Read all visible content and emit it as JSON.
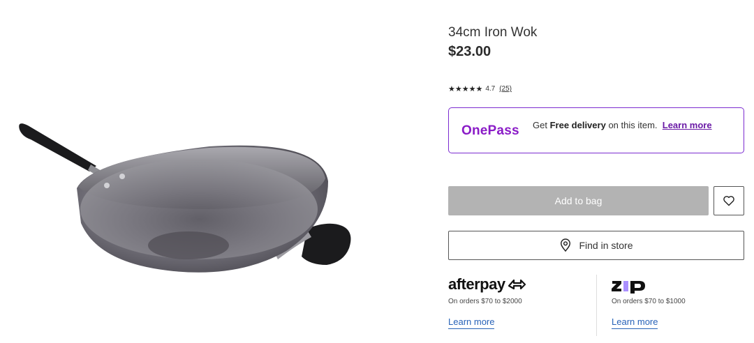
{
  "product": {
    "title": "34cm Iron Wok",
    "price": "$23.00",
    "rating": {
      "stars": "★★★★★",
      "value": 4.7,
      "score_text": "4.7",
      "count_text": "(25)"
    }
  },
  "onepass": {
    "logo": "OnePass",
    "text_before": "Get",
    "text_bold": "Free delivery",
    "text_after": "on this item.",
    "learn_more": "Learn more"
  },
  "actions": {
    "add_to_bag": "Add to bag",
    "find_in_store": "Find in store",
    "wishlist_icon": "heart-icon",
    "store_icon": "location-pin-icon"
  },
  "payments": {
    "afterpay": {
      "brand": "afterpay",
      "desc": "On orders $70 to $2000",
      "learn_more": "Learn more"
    },
    "zip": {
      "brand": "zip",
      "desc": "On orders $70 to $1000",
      "learn_more": "Learn more"
    }
  },
  "colors": {
    "onepass_purple": "#8a1bc7",
    "disabled_button": "#b3b3b3",
    "link_blue": "#2762b8",
    "zip_purple": "#aa8fff"
  }
}
